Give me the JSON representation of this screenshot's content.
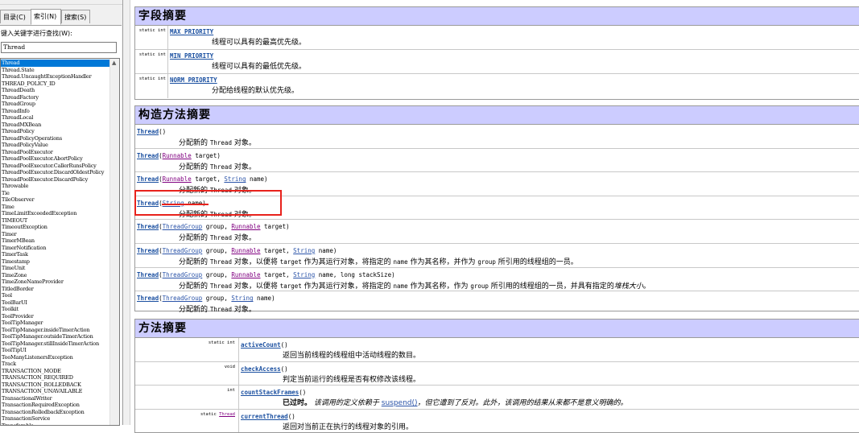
{
  "left_pane": {
    "menu": [
      "目录",
      "目录",
      "目录",
      "目录"
    ],
    "tabs": [
      {
        "label": "目录(C)"
      },
      {
        "label": "索引(N)"
      },
      {
        "label": "搜索(S)"
      }
    ],
    "keyword_label": "键入关键字进行查找(W):",
    "keyword_value": "Thread",
    "index_items": [
      "Thread",
      "Thread.State",
      "Thread.UncaughtExceptionHandler",
      "THREAD_POLICY_ID",
      "ThreadDeath",
      "ThreadFactory",
      "ThreadGroup",
      "ThreadInfo",
      "ThreadLocal",
      "ThreadMXBean",
      "ThreadPolicy",
      "ThreadPolicyOperations",
      "ThreadPolicyValue",
      "ThreadPoolExecutor",
      "ThreadPoolExecutor.AbortPolicy",
      "ThreadPoolExecutor.CallerRunsPolicy",
      "ThreadPoolExecutor.DiscardOldestPolicy",
      "ThreadPoolExecutor.DiscardPolicy",
      "Throwable",
      "Tie",
      "TileObserver",
      "Time",
      "TimeLimitExceededException",
      "TIMEOUT",
      "TimeoutException",
      "Timer",
      "TimerMBean",
      "TimerNotification",
      "TimerTask",
      "Timestamp",
      "TimeUnit",
      "TimeZone",
      "TimeZoneNameProvider",
      "TitledBorder",
      "Tool",
      "ToolBarUI",
      "Toolkit",
      "ToolProvider",
      "ToolTipManager",
      "ToolTipManager.insideTimerAction",
      "ToolTipManager.outsideTimerAction",
      "ToolTipManager.stillInsideTimerAction",
      "ToolTipUI",
      "TooManyListenersException",
      "Track",
      "TRANSACTION_MODE",
      "TRANSACTION_REQUIRED",
      "TRANSACTION_ROLLEDBACK",
      "TRANSACTION_UNAVAILABLE",
      "TransactionalWriter",
      "TransactionRequiredException",
      "TransactionRolledbackException",
      "TransactionService",
      "Transferable"
    ],
    "selected_index": 0
  },
  "fields": {
    "title": "字段摘要",
    "rows": [
      {
        "modifier": "static int",
        "name": "MAX_PRIORITY",
        "desc": "线程可以具有的最高优先级。"
      },
      {
        "modifier": "static int",
        "name": "MIN_PRIORITY",
        "desc": "线程可以具有的最低优先级。"
      },
      {
        "modifier": "static int",
        "name": "NORM_PRIORITY",
        "desc": "分配给线程的默认优先级。"
      }
    ]
  },
  "constructors": {
    "title": "构造方法摘要",
    "rows": [
      {
        "sig": [
          {
            "t": "Thread",
            "k": "link"
          },
          {
            "t": "()",
            "k": "plain"
          }
        ],
        "desc": [
          {
            "t": "分配新的 ",
            "k": "plain"
          },
          {
            "t": "Thread",
            "k": "code"
          },
          {
            "t": " 对象。",
            "k": "plain"
          }
        ]
      },
      {
        "sig": [
          {
            "t": "Thread",
            "k": "link"
          },
          {
            "t": "(",
            "k": "plain"
          },
          {
            "t": "Runnable",
            "k": "tlink"
          },
          {
            "t": " target)",
            "k": "plain"
          }
        ],
        "desc": [
          {
            "t": "分配新的 ",
            "k": "plain"
          },
          {
            "t": "Thread",
            "k": "code"
          },
          {
            "t": " 对象。",
            "k": "plain"
          }
        ]
      },
      {
        "sig": [
          {
            "t": "Thread",
            "k": "link"
          },
          {
            "t": "(",
            "k": "plain"
          },
          {
            "t": "Runnable",
            "k": "tlink"
          },
          {
            "t": " target, ",
            "k": "plain"
          },
          {
            "t": "String",
            "k": "tlinkb"
          },
          {
            "t": " name)",
            "k": "plain"
          }
        ],
        "desc": [
          {
            "t": "分配新的 ",
            "k": "plain"
          },
          {
            "t": "Thread",
            "k": "code"
          },
          {
            "t": " 对象。",
            "k": "plain"
          }
        ]
      },
      {
        "sig": [
          {
            "t": "Thread",
            "k": "link"
          },
          {
            "t": "(",
            "k": "plain"
          },
          {
            "t": "String",
            "k": "tlinkb"
          },
          {
            "t": " name)",
            "k": "plain"
          }
        ],
        "desc": [
          {
            "t": "分配新的 ",
            "k": "plain"
          },
          {
            "t": "Thread",
            "k": "code"
          },
          {
            "t": " 对象。",
            "k": "plain"
          }
        ]
      },
      {
        "sig": [
          {
            "t": "Thread",
            "k": "link"
          },
          {
            "t": "(",
            "k": "plain"
          },
          {
            "t": "ThreadGroup",
            "k": "tlinkb"
          },
          {
            "t": " group, ",
            "k": "plain"
          },
          {
            "t": "Runnable",
            "k": "tlink"
          },
          {
            "t": " target)",
            "k": "plain"
          }
        ],
        "desc": [
          {
            "t": "分配新的 ",
            "k": "plain"
          },
          {
            "t": "Thread",
            "k": "code"
          },
          {
            "t": " 对象。",
            "k": "plain"
          }
        ]
      },
      {
        "sig": [
          {
            "t": "Thread",
            "k": "link"
          },
          {
            "t": "(",
            "k": "plain"
          },
          {
            "t": "ThreadGroup",
            "k": "tlinkb"
          },
          {
            "t": " group, ",
            "k": "plain"
          },
          {
            "t": "Runnable",
            "k": "tlink"
          },
          {
            "t": " target, ",
            "k": "plain"
          },
          {
            "t": "String",
            "k": "tlinkb"
          },
          {
            "t": " name)",
            "k": "plain"
          }
        ],
        "desc": [
          {
            "t": "分配新的 ",
            "k": "plain"
          },
          {
            "t": "Thread",
            "k": "code"
          },
          {
            "t": " 对象，以便将 ",
            "k": "plain"
          },
          {
            "t": "target",
            "k": "code"
          },
          {
            "t": " 作为其运行对象，将指定的 ",
            "k": "plain"
          },
          {
            "t": "name",
            "k": "code"
          },
          {
            "t": " 作为其名称，并作为 ",
            "k": "plain"
          },
          {
            "t": "group",
            "k": "code"
          },
          {
            "t": " 所引用的线程组的一员。",
            "k": "plain"
          }
        ]
      },
      {
        "sig": [
          {
            "t": "Thread",
            "k": "link"
          },
          {
            "t": "(",
            "k": "plain"
          },
          {
            "t": "ThreadGroup",
            "k": "tlinkb"
          },
          {
            "t": " group, ",
            "k": "plain"
          },
          {
            "t": "Runnable",
            "k": "tlink"
          },
          {
            "t": " target, ",
            "k": "plain"
          },
          {
            "t": "String",
            "k": "tlinkb"
          },
          {
            "t": " name, long stackSize)",
            "k": "plain"
          }
        ],
        "desc": [
          {
            "t": "分配新的 ",
            "k": "plain"
          },
          {
            "t": "Thread",
            "k": "code"
          },
          {
            "t": " 对象，以便将 ",
            "k": "plain"
          },
          {
            "t": "target",
            "k": "code"
          },
          {
            "t": " 作为其运行对象，将指定的 ",
            "k": "plain"
          },
          {
            "t": "name",
            "k": "code"
          },
          {
            "t": " 作为其名称，作为 ",
            "k": "plain"
          },
          {
            "t": "group",
            "k": "code"
          },
          {
            "t": " 所引用的线程组的一员，并具有指定的",
            "k": "plain"
          },
          {
            "t": "堆栈大小",
            "k": "it"
          },
          {
            "t": "。",
            "k": "plain"
          }
        ]
      },
      {
        "sig": [
          {
            "t": "Thread",
            "k": "link"
          },
          {
            "t": "(",
            "k": "plain"
          },
          {
            "t": "ThreadGroup",
            "k": "tlinkb"
          },
          {
            "t": " group, ",
            "k": "plain"
          },
          {
            "t": "String",
            "k": "tlinkb"
          },
          {
            "t": " name)",
            "k": "plain"
          }
        ],
        "desc": [
          {
            "t": "分配新的 ",
            "k": "plain"
          },
          {
            "t": "Thread",
            "k": "code"
          },
          {
            "t": " 对象。",
            "k": "plain"
          }
        ]
      }
    ]
  },
  "methods": {
    "title": "方法摘要",
    "rows": [
      {
        "modifier": "static int",
        "name": "activeCount",
        "params": "()",
        "desc": [
          {
            "t": "返回当前线程的线程组中活动线程的数目。",
            "k": "plain"
          }
        ]
      },
      {
        "modifier": "void",
        "name": "checkAccess",
        "params": "()",
        "desc": [
          {
            "t": "判定当前运行的线程是否有权修改该线程。",
            "k": "plain"
          }
        ]
      },
      {
        "modifier": "int",
        "name": "countStackFrames",
        "params": "()",
        "desc": [
          {
            "t": "已过时。",
            "k": "bold"
          },
          {
            "t": " 该调用的定义依赖于 ",
            "k": "it"
          },
          {
            "t": "suspend()",
            "k": "tlinkb"
          },
          {
            "t": "，但它遭到了反对。此外，该调用的结果从来都不是意义明确的。",
            "k": "it"
          }
        ]
      },
      {
        "modifier": "static Thread",
        "name": "currentThread",
        "params": "()",
        "desc": [
          {
            "t": "返回对当前正在执行的线程对象的引用。",
            "k": "plain"
          }
        ]
      }
    ]
  },
  "highlight_color": "#e8221c",
  "header_bg": "#ccccff"
}
